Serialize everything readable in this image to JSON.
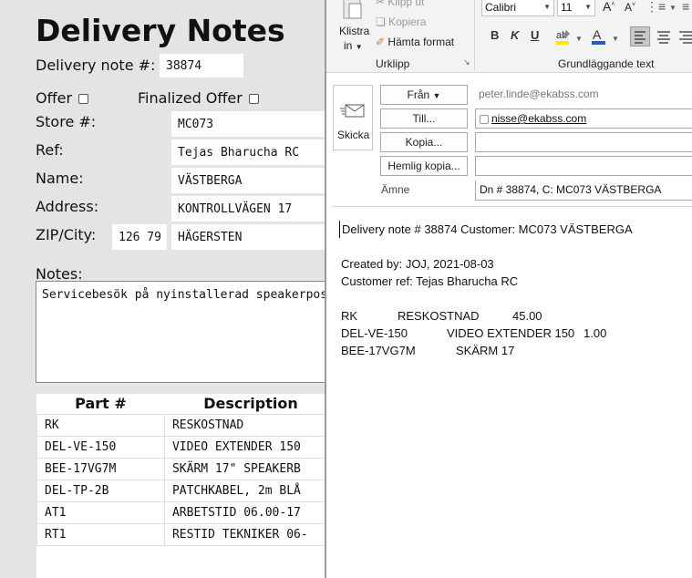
{
  "form": {
    "title": "Delivery Notes",
    "delivery_note_label": "Delivery note #:",
    "delivery_note_value": "38874",
    "offer_label": "Offer",
    "finalized_offer_label": "Finalized Offer",
    "store_label": "Store #:",
    "store_value": "MC073",
    "ref_label": "Ref:",
    "ref_value": "Tejas Bharucha RC",
    "name_label": "Name:",
    "name_value": "VÄSTBERGA",
    "address_label": "Address:",
    "address_value": "KONTROLLVÄGEN 17",
    "zip_label": "ZIP/City:",
    "zip_value": "126 79",
    "city_value": "HÄGERSTEN",
    "notes_label": "Notes:",
    "notes_value": "Servicebesök på nyinstallerad speakerpost då",
    "table": {
      "headers": [
        "Part #",
        "Description"
      ],
      "rows": [
        [
          "RK",
          "RESKOSTNAD"
        ],
        [
          "DEL-VE-150",
          "VIDEO EXTENDER 150"
        ],
        [
          "BEE-17VG7M",
          "SKÄRM 17\" SPEAKERB"
        ],
        [
          "DEL-TP-2B",
          "PATCHKABEL, 2m BLÅ"
        ],
        [
          "AT1",
          "ARBETSTID  06.00-17"
        ],
        [
          "RT1",
          "RESTID TEKNIKER 06-"
        ]
      ]
    }
  },
  "mail": {
    "ribbon": {
      "paste_label_1": "Klistra",
      "paste_label_2": "in",
      "cut_label": "Klipp ut",
      "copy_label": "Kopiera",
      "format_painter_label": "Hämta format",
      "clipboard_group": "Urklipp",
      "font_name": "Calibri",
      "font_size": "11",
      "text_group": "Grundläggande text",
      "bold": "B",
      "italic": "K",
      "underline": "U"
    },
    "send_label": "Skicka",
    "from_button": "Från",
    "from_value": "peter.linde@ekabss.com",
    "to_button": "Till...",
    "to_value": "nisse@ekabss.com",
    "cc_button": "Kopia...",
    "bcc_button": "Hemlig kopia...",
    "subject_label": "Ämne",
    "subject_value": "Dn # 38874, C: MC073 VÄSTBERGA",
    "body": {
      "line1": "Delivery note # 38874 Customer: MC073 VÄSTBERGA",
      "line2": "Created by: JOJ, 2021-08-03",
      "line3": "Customer ref: Tejas Bharucha RC",
      "items": [
        {
          "part": "RK",
          "desc": "RESKOSTNAD",
          "qty": "45.00"
        },
        {
          "part": "DEL-VE-150",
          "desc": "VIDEO EXTENDER 150",
          "qty": "1.00"
        },
        {
          "part": "BEE-17VG7M",
          "desc": "SKÄRM 17",
          "qty": ""
        }
      ]
    }
  }
}
